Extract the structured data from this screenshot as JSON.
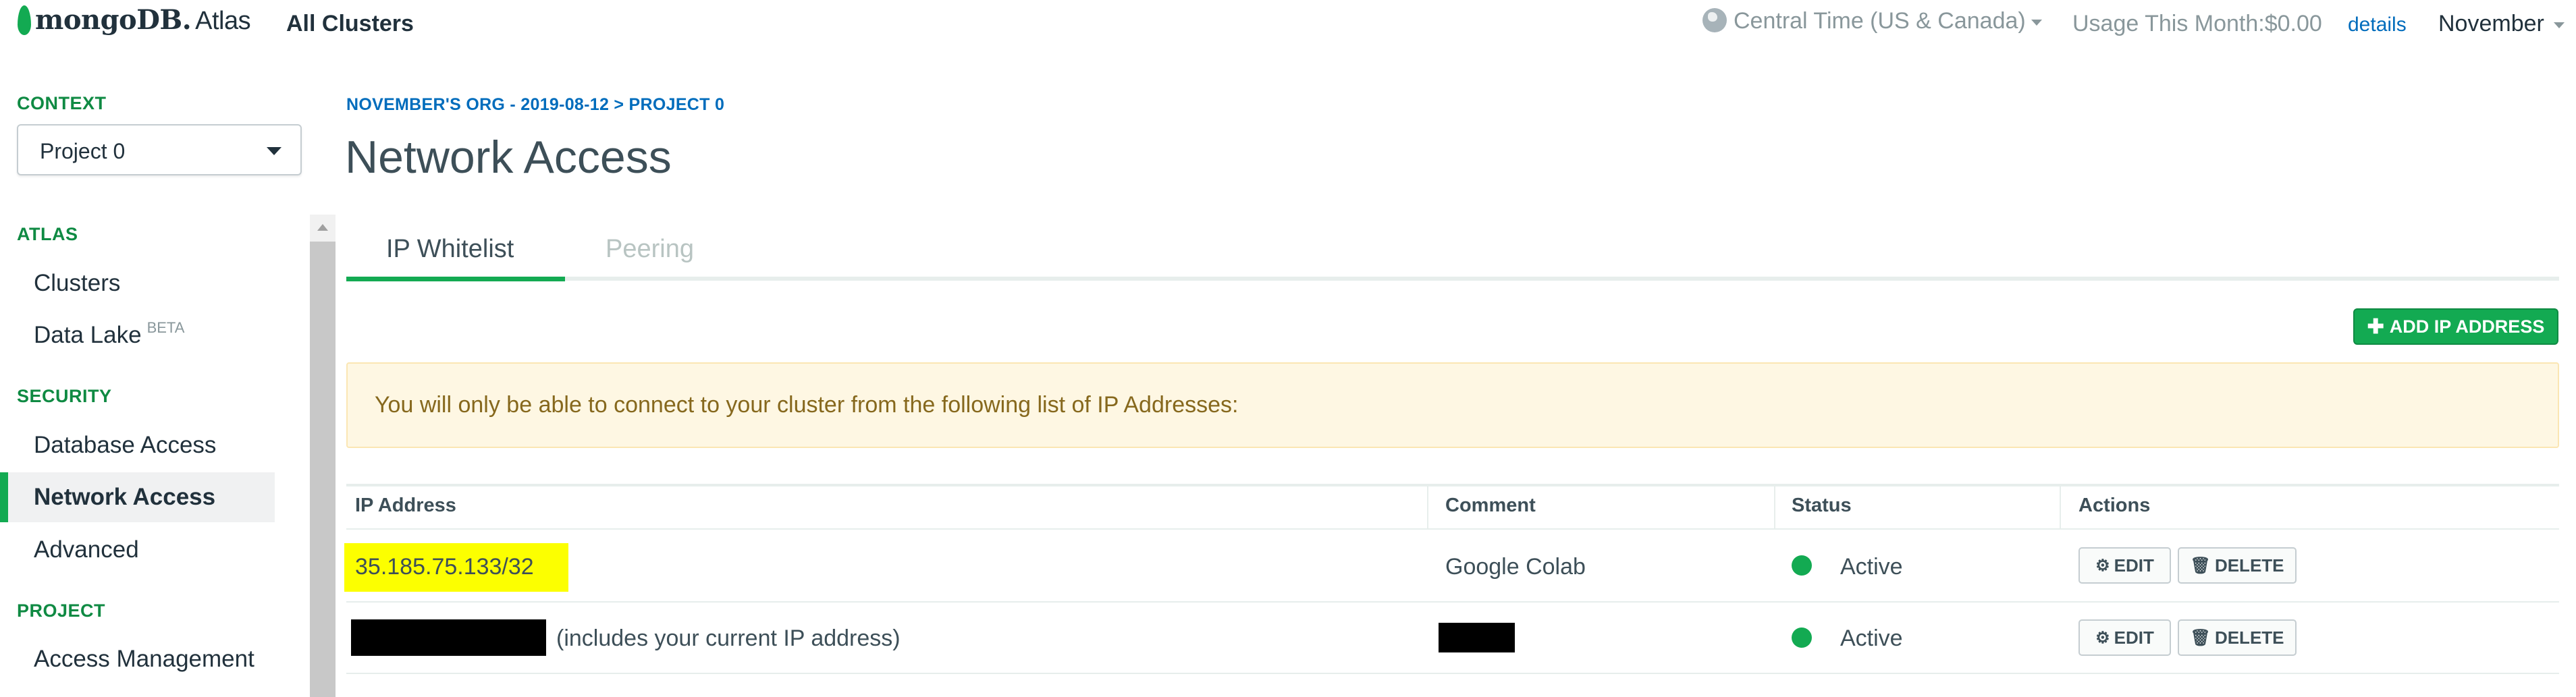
{
  "brand": {
    "logo_text": "mongoDB.",
    "product": "Atlas"
  },
  "header": {
    "all_clusters": "All Clusters",
    "timezone": "Central Time (US & Canada)",
    "usage": "Usage This Month:$0.00",
    "usage_details": "details",
    "user_menu": "November"
  },
  "sidebar": {
    "context_label": "CONTEXT",
    "project_select": "Project 0",
    "sections": {
      "atlas": "ATLAS",
      "security": "SECURITY",
      "project": "PROJECT"
    },
    "items": {
      "clusters": "Clusters",
      "data_lake": "Data Lake",
      "data_lake_badge": "BETA",
      "database_access": "Database Access",
      "network_access": "Network Access",
      "advanced": "Advanced",
      "access_management": "Access Management"
    }
  },
  "main": {
    "breadcrumb": "NOVEMBER'S ORG - 2019-08-12 > PROJECT 0",
    "title": "Network Access",
    "tabs": [
      "IP Whitelist",
      "Peering"
    ],
    "add_button": "ADD IP ADDRESS",
    "notice": "You will only be able to connect to your cluster from the following list of IP Addresses:",
    "table": {
      "headers": [
        "IP Address",
        "Comment",
        "Status",
        "Actions"
      ],
      "rows": [
        {
          "ip": "35.185.75.133/32",
          "comment": "Google Colab",
          "status": "Active"
        },
        {
          "ip_note": "(includes your current IP address)",
          "status": "Active"
        }
      ],
      "edit_label": "EDIT",
      "delete_label": "DELETE"
    }
  },
  "colors": {
    "accent_green": "#13aa52",
    "link_blue": "#006cbc",
    "highlight_yellow": "#fcff00",
    "notice_text": "#86681d"
  }
}
